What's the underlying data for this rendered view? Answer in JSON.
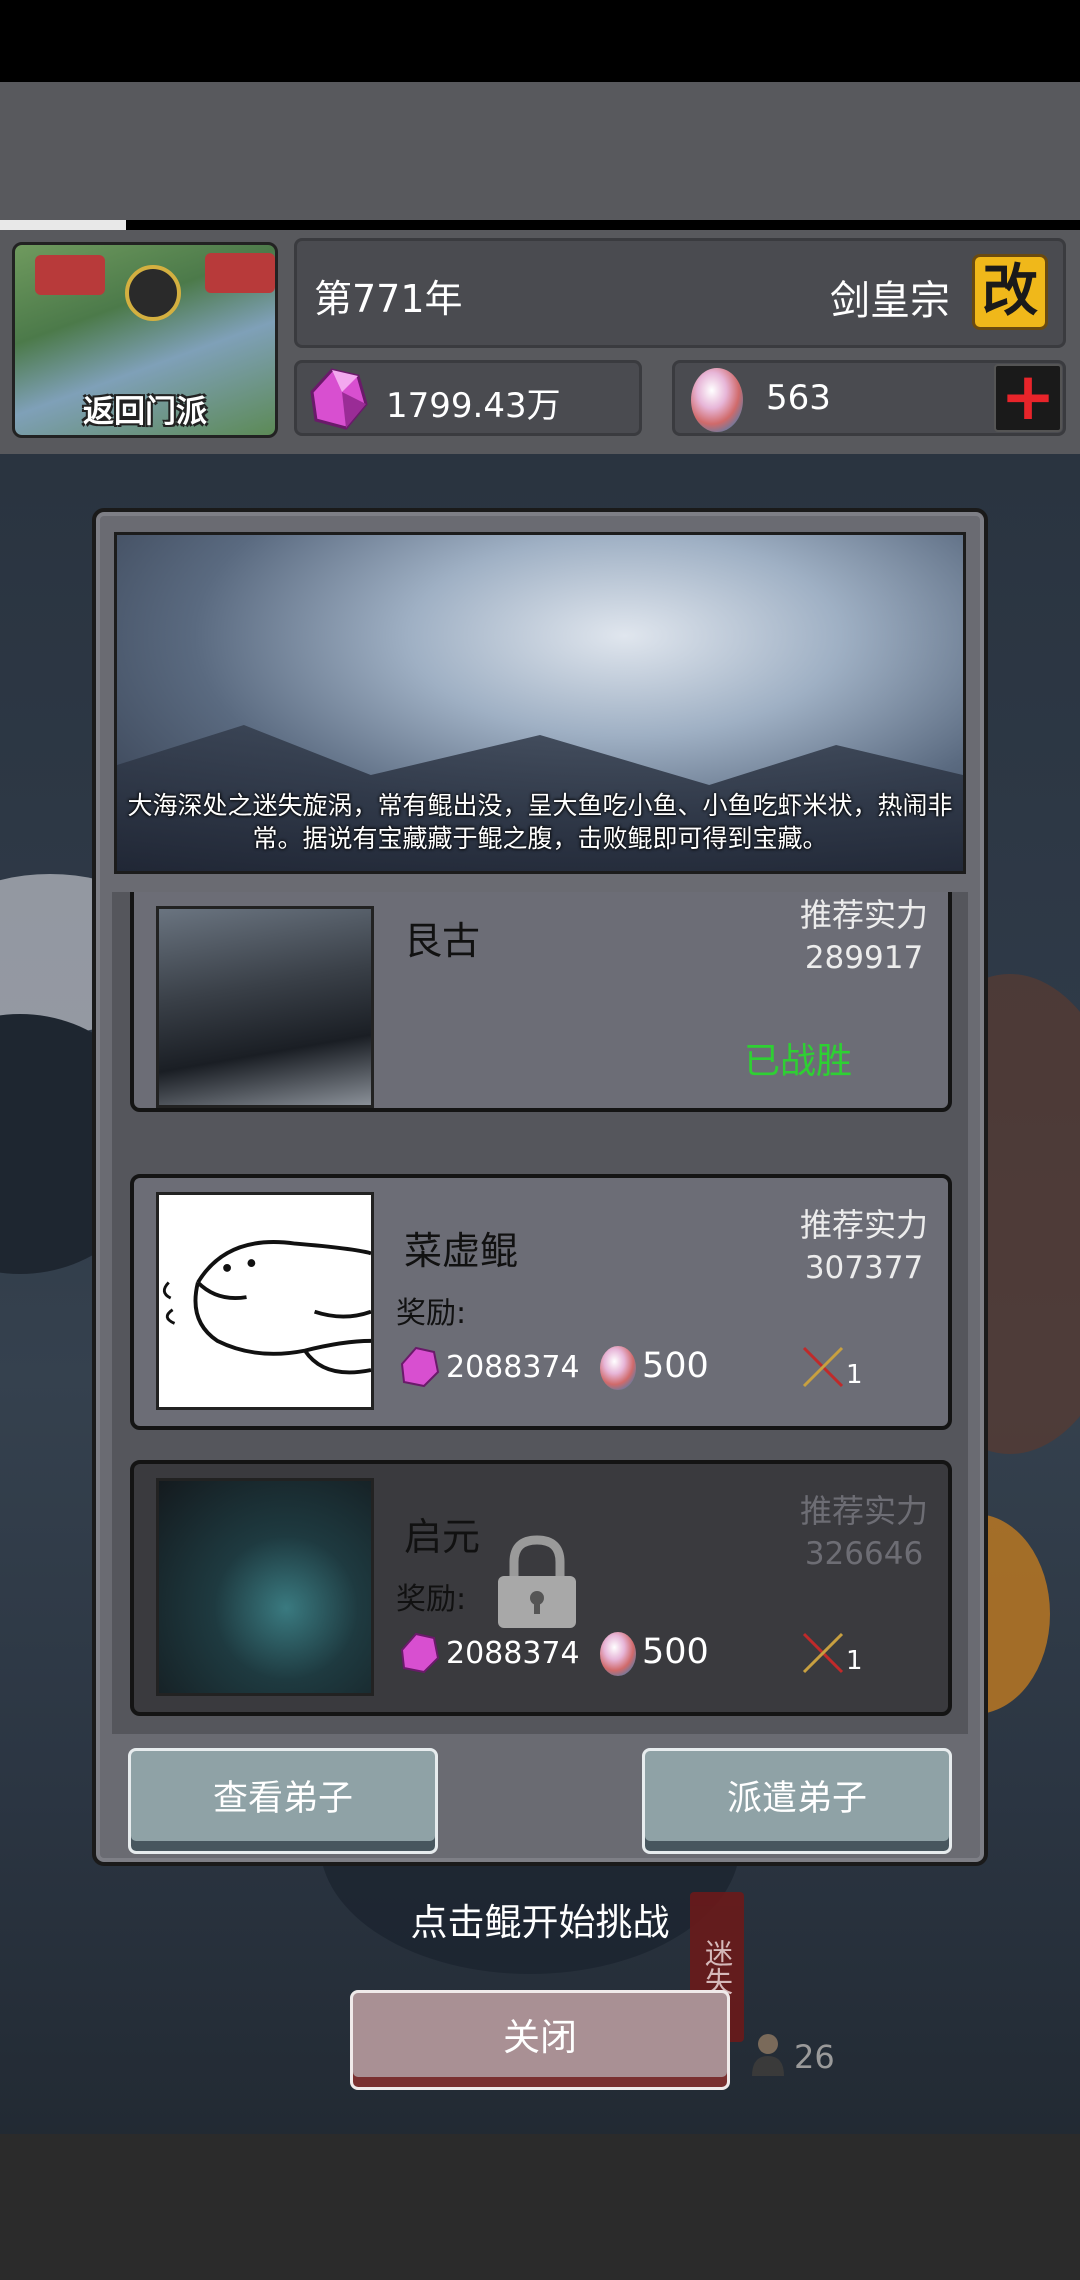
{
  "hud": {
    "back_label": "返回门派",
    "year": "第771年",
    "sect_name": "剑皇宗",
    "rename_label": "改",
    "spirit_stones": "1799.43万",
    "spirit_eggs": "563",
    "add_label": "+"
  },
  "dialog": {
    "description": "大海深处之迷失旋涡，常有鲲出没，呈大鱼吃小鱼、小鱼吃虾米状，热闹非常。据说有宝藏藏于鲲之腹，击败鲲即可得到宝藏。",
    "cards": [
      {
        "name": "艮古",
        "rec_label": "推荐实力",
        "rec_value": "289917",
        "status": "已战胜"
      },
      {
        "name": "菜虚鲲",
        "rec_label": "推荐实力",
        "rec_value": "307377",
        "reward_label": "奖励:",
        "reward_stones": "2088374",
        "reward_eggs": "500",
        "reward_swords": "1"
      },
      {
        "name": "启元",
        "rec_label": "推荐实力",
        "rec_value": "326646",
        "reward_label": "奖励:",
        "reward_stones": "2088374",
        "reward_eggs": "500",
        "reward_swords": "1",
        "locked": true
      }
    ],
    "view_button": "查看弟子",
    "send_button": "派遣弟子"
  },
  "hint": "点击鲲开始挑战",
  "close_button": "关闭",
  "side_banner": "迷失",
  "disciple_count": "26",
  "colors": {
    "won": "#2ed033",
    "rename_bg": "#f0b81a",
    "add_icon": "#e8242a"
  }
}
